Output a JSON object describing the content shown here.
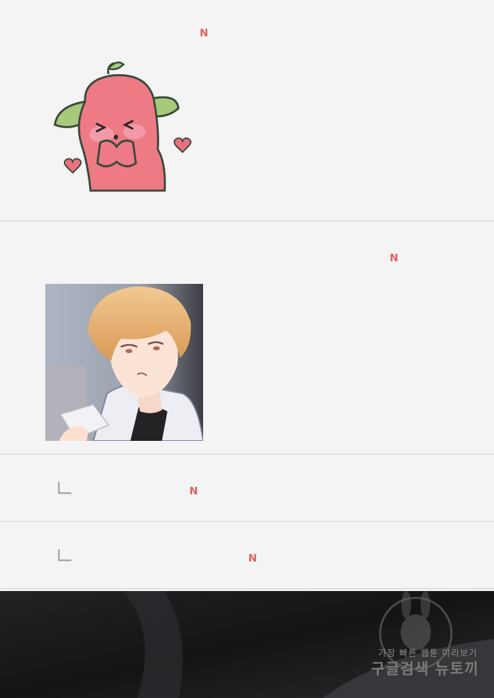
{
  "comments": [
    {
      "new_badge": "N",
      "sticker": "pink-mascot-sticker",
      "type": "sticker"
    },
    {
      "new_badge": "N",
      "image": "character-thumbnail",
      "type": "image"
    },
    {
      "new_badge": "N",
      "type": "reply"
    },
    {
      "new_badge": "N",
      "type": "reply"
    }
  ],
  "banner": {
    "watermark_line1": "가장 빠른 웹툰 미리보기",
    "watermark_line2": "구글검색 뉴토끼"
  },
  "colors": {
    "background": "#f4f4f4",
    "divider": "#cfcfcf",
    "new_badge": "#e0625d",
    "banner": "#1b1b1d"
  }
}
